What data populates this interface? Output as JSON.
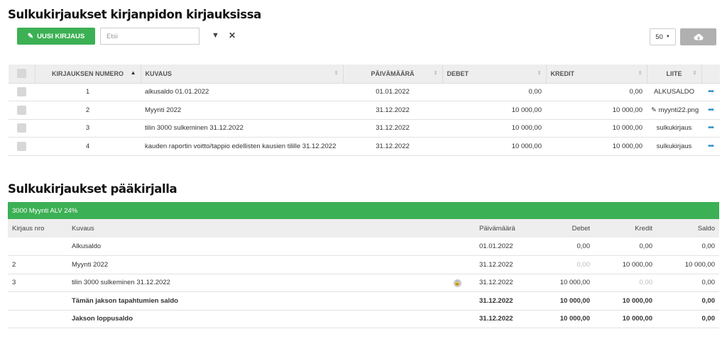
{
  "page": {
    "title1": "Sulkukirjaukset kirjanpidon kirjauksissa",
    "title2": "Sulkukirjaukset pääkirjalla"
  },
  "toolbar": {
    "new_button": "UUSI KIRJAUS",
    "search_placeholder": "Etsi",
    "page_size": "50"
  },
  "entries": {
    "headers": [
      "KIRJAUKSEN NUMERO",
      "KUVAUS",
      "PÄIVÄMÄÄRÄ",
      "DEBET",
      "KREDIT",
      "LIITE"
    ],
    "rows": [
      {
        "num": "1",
        "desc": "alkusaldo 01.01.2022",
        "date": "01.01.2022",
        "debit": "0,00",
        "credit": "0,00",
        "attachment": "ALKUSALDO",
        "link": false
      },
      {
        "num": "2",
        "desc": "Myynti 2022",
        "date": "31.12.2022",
        "debit": "10 000,00",
        "credit": "10 000,00",
        "attachment": "myynti22.png",
        "link": true
      },
      {
        "num": "3",
        "desc": "tilin 3000 sulkeminen 31.12.2022",
        "date": "31.12.2022",
        "debit": "10 000,00",
        "credit": "10 000,00",
        "attachment": "sulkukirjaus",
        "link": false
      },
      {
        "num": "4",
        "desc": "kauden raportin voitto/tappio edellisten kausien tilille 31.12.2022",
        "date": "31.12.2022",
        "debit": "10 000,00",
        "credit": "10 000,00",
        "attachment": "sulkukirjaus",
        "link": false
      }
    ]
  },
  "ledger": {
    "account": "3000 Myynti ALV 24%",
    "headers": [
      "Kirjaus nro",
      "Kuvaus",
      "Päivämäärä",
      "Debet",
      "Kredit",
      "Saldo"
    ],
    "rows": [
      {
        "num": "",
        "desc": "Alkusaldo",
        "date": "01.01.2022",
        "debit": "0,00",
        "credit": "0,00",
        "balance": "0,00",
        "bold": false,
        "debit_muted": false,
        "credit_muted": false,
        "lock": false
      },
      {
        "num": "2",
        "desc": "Myynti 2022",
        "date": "31.12.2022",
        "debit": "0,00",
        "credit": "10 000,00",
        "balance": "10 000,00",
        "bold": false,
        "debit_muted": true,
        "credit_muted": false,
        "lock": false
      },
      {
        "num": "3",
        "desc": "tilin 3000 sulkeminen 31.12.2022",
        "date": "31.12.2022",
        "debit": "10 000,00",
        "credit": "0,00",
        "balance": "0,00",
        "bold": false,
        "debit_muted": false,
        "credit_muted": true,
        "lock": true
      },
      {
        "num": "",
        "desc": "Tämän jakson tapahtumien saldo",
        "date": "31.12.2022",
        "debit": "10 000,00",
        "credit": "10 000,00",
        "balance": "0,00",
        "bold": true,
        "debit_muted": false,
        "credit_muted": false,
        "lock": false
      },
      {
        "num": "",
        "desc": "Jakson loppusaldo",
        "date": "31.12.2022",
        "debit": "10 000,00",
        "credit": "10 000,00",
        "balance": "0,00",
        "bold": true,
        "debit_muted": false,
        "credit_muted": false,
        "lock": false
      }
    ]
  },
  "colors": {
    "green": "#3cb054",
    "link": "#2a8fc4",
    "header_bg": "#eeeeee"
  }
}
